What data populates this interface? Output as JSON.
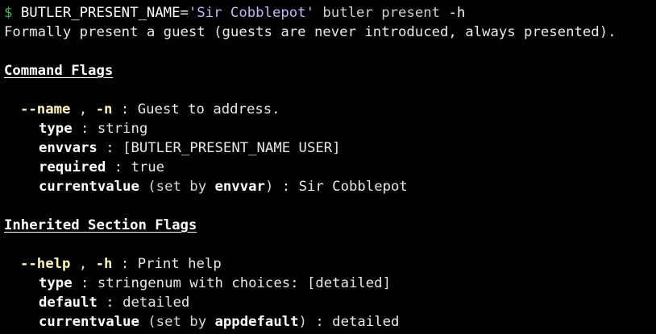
{
  "command": {
    "prompt": "$",
    "env_assign": "BUTLER_PRESENT_NAME=",
    "env_value": "'Sir Cobblepot'",
    "program": "butler",
    "subcommand": "present",
    "flag": "-h"
  },
  "description": "Formally present a guest (guests are never introduced, always presented).",
  "sections": [
    {
      "heading": "Command Flags",
      "flags": [
        {
          "long": "--name",
          "sep": " , ",
          "short": "-n",
          "colon": " : ",
          "help": "Guest to address.",
          "type_label": "type",
          "type_value": "string",
          "envvars_label": "envvars",
          "envvars_value": "[BUTLER_PRESENT_NAME USER]",
          "required_label": "required",
          "required_value": "true",
          "current_label": "currentvalue",
          "current_setby_prefix": " (set by ",
          "current_setby": "envvar",
          "current_setby_suffix": ")",
          "current_value": "Sir Cobblepot"
        }
      ]
    },
    {
      "heading": "Inherited Section Flags",
      "flags": [
        {
          "long": "--help",
          "sep": " , ",
          "short": "-h",
          "colon": " : ",
          "help": "Print help",
          "type_label": "type",
          "type_value": "stringenum with choices: [detailed]",
          "default_label": "default",
          "default_value": "detailed",
          "current_label": "currentvalue",
          "current_setby_prefix": " (set by ",
          "current_setby": "appdefault",
          "current_setby_suffix": ")",
          "current_value": "detailed"
        }
      ]
    }
  ],
  "colors": {
    "background": "#000000",
    "prompt": "#3fb950",
    "string_literal": "#c4b5fd",
    "flag": "#fff7b0",
    "text": "#e8e8e8"
  }
}
